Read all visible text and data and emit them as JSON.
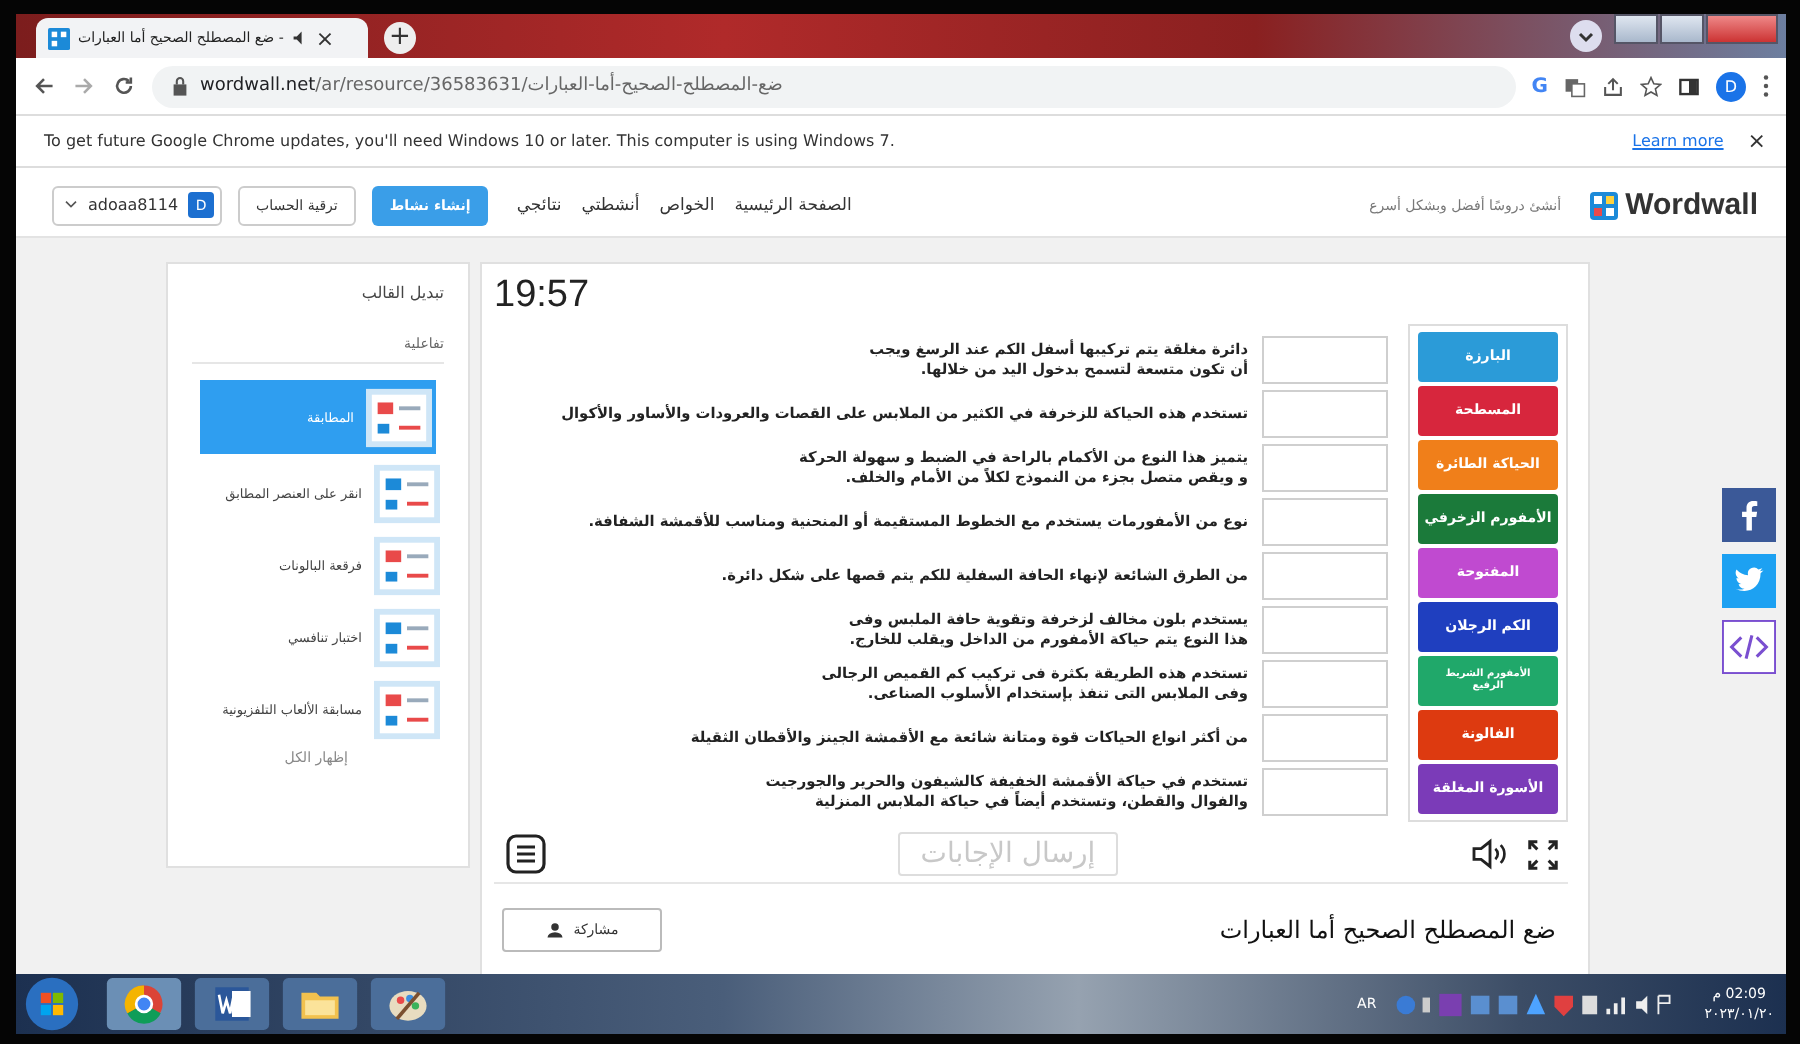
{
  "browser": {
    "tab": {
      "title": "ضع المصطلح الصحيح أما العبارات -",
      "close": "×"
    },
    "new_tab": "+",
    "url_host": "wordwall.net",
    "url_path": "/ar/resource/36583631/ضع-المصطلح-الصحيح-أما-العبارات",
    "profile": "D",
    "google_icon": "G",
    "info_bar": {
      "message": "To get future Google Chrome updates, you'll need Windows 10 or later. This computer is using Windows 7.",
      "link": "Learn more",
      "close": "×"
    }
  },
  "header": {
    "logo": "Wordwall",
    "tagline": "أنشئ دروسًا أفضل وبشكل أسرع",
    "nav": [
      "الصفحة الرئيسية",
      "الخواص",
      "أنشطتي",
      "نتائجي"
    ],
    "create_button": "إنشاء نشاط",
    "upgrade_button": "ترقية الحساب",
    "avatar": "D",
    "username": "adoaa8114"
  },
  "sidebar": {
    "title": "تبديل القالب",
    "section": "تفاعلية",
    "items": [
      {
        "label": "المطابقة",
        "selected": true
      },
      {
        "label": "انقر على العنصر المطابق",
        "selected": false
      },
      {
        "label": "فرقعة البالونات",
        "selected": false
      },
      {
        "label": "اختبار تنافسي",
        "selected": false
      },
      {
        "label": "مسابقة الألعاب التلفزيونية",
        "selected": false
      }
    ],
    "show_all": "إظهار الكل"
  },
  "game": {
    "timer": "19:57",
    "rows": [
      {
        "lines": [
          "دائرة مغلقة يتم تركيبها أسفل الكم عند الرسغ ويجب",
          "أن تكون متسعة لتسمح بدخول اليد من خلالها."
        ]
      },
      {
        "lines": [
          "تستخدم هذه الحياكة للزخرفة في الكثير من الملابس على القصات والعرودات والأساور والأكوال"
        ]
      },
      {
        "lines": [
          "يتميز هذا النوع من الأكمام بالراحة في الضبط و سهولة الحركة",
          "و ويقص متصل بجزء من النموذج لكلاً من الأمام والخلف."
        ]
      },
      {
        "lines": [
          "نوع من الأمفورمات يستخدم مع الخطوط المستقيمة أو المنحنية ومناسب للأقمشة الشفافة."
        ]
      },
      {
        "lines": [
          "من الطرق الشائعة لإنهاء الحافة السفلية للكم يتم قصها على شكل دائرة."
        ]
      },
      {
        "lines": [
          "يستخدم بلون مخالف لزخرفة وتقوية حافة الملبس وفى",
          "هذا النوع يتم حياكة الأمفورم من الداخل ويقلب للخارج."
        ]
      },
      {
        "lines": [
          "تستخدم هذه الطريقة بكثرة فى تركيب كم القميص الرجالى",
          "وفى الملابس التى تنفذ بإستخدام الأسلوب الصناعى."
        ]
      },
      {
        "lines": [
          "من أكثر انواع الحياكات قوة ومتانة شائعة مع الأقمشة الجينز والأقطان الثقيلة"
        ]
      },
      {
        "lines": [
          "تستخدم في حياكة الأقمشة الخفيفة كالشيفون والحرير والجورجيت",
          "والفوال والقطن، وتستخدم أيضاً في حياكة الملابس المنزلية"
        ]
      }
    ],
    "tiles": [
      {
        "label": "البارزة",
        "color": "#2b9bd8",
        "kind": "normal"
      },
      {
        "label": "المسطحة",
        "color": "#d7263d",
        "kind": "normal"
      },
      {
        "label": "الحياكة الطائرة",
        "color": "#f07f1a",
        "kind": "normal"
      },
      {
        "label": "الأمفورم الزخرفي",
        "color": "#1b7a3a",
        "kind": "normal"
      },
      {
        "label": "المفتوحة",
        "color": "#c04ad0",
        "kind": "normal"
      },
      {
        "label": "الكم الرجلان",
        "color": "#1f3fbf",
        "kind": "normal"
      },
      {
        "label": "الأمفورم الشريط الرفيع",
        "color": "#20a86a",
        "kind": "compact"
      },
      {
        "label": "الفالونة",
        "color": "#dd3a10",
        "kind": "normal"
      },
      {
        "label": "الأسورة المغلقة",
        "color": "#7b3bb8",
        "kind": "normal"
      }
    ],
    "submit": {
      "label": "إرسال الإجابات",
      "disabled": true
    }
  },
  "activity": {
    "title": "ضع المصطلح الصحيح أما العبارات",
    "share_button": "مشاركة"
  },
  "taskbar": {
    "language": "AR",
    "time": "02:09 م",
    "date": "٢٠٢٣/٠١/٢٠"
  }
}
